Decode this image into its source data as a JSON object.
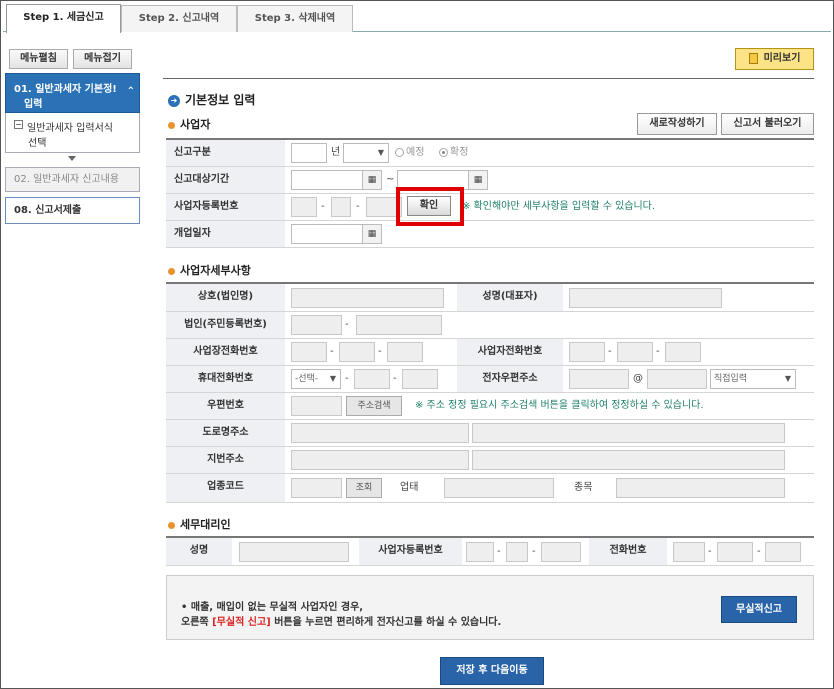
{
  "tabs": [
    "Step 1. 세금신고",
    "Step 2. 신고내역",
    "Step 3. 삭제내역"
  ],
  "sidebar": {
    "expand_label": "메뉴펼침",
    "collapse_label": "메뉴접기",
    "items": [
      {
        "label": "01. 일반과세자 기본정보 입력",
        "label1": "01. 일반과세자 기본정!",
        "label2": "입력"
      },
      {
        "label": "일반과세자 입력서식 선택",
        "label1": "일반과세자 입력서식",
        "label2": "선택"
      },
      {
        "label": "02. 일반과세자 신고내용"
      },
      {
        "label": "08. 신고서제출"
      }
    ]
  },
  "preview_label": "미리보기",
  "page_title": "기본정보 입력",
  "sections": {
    "business": "사업자",
    "details": "사업자세부사항",
    "agent": "세무대리인"
  },
  "buttons": {
    "new": "새로작성하기",
    "load": "신고서 불러오기",
    "confirm": "확인",
    "address_search": "주소검색",
    "lookup": "조회",
    "no_business_report": "무실적신고",
    "save_next": "저장 후 다음이동"
  },
  "labels": {
    "report_type": "신고구분",
    "period": "신고대상기간",
    "biz_reg_no": "사업자등록번호",
    "open_date": "개업일자",
    "company": "상호(법인명)",
    "rep_name": "성명(대표자)",
    "corp_reg_no": "법인(주민등록번호)",
    "office_phone": "사업장전화번호",
    "biz_phone": "사업자전화번호",
    "mobile": "휴대전화번호",
    "email": "전자우편주소",
    "zipcode": "우편번호",
    "road_address": "도로명주소",
    "lot_address": "지번주소",
    "industry_code": "업종코드",
    "business_type": "업태",
    "item": "종목",
    "agent_name": "성명",
    "agent_biz_no": "사업자등록번호",
    "agent_phone": "전화번호"
  },
  "text": {
    "year": "년",
    "tilde": "~",
    "dash": "-",
    "at": "@",
    "radio_planned": "예정",
    "radio_final": "확정",
    "confirm_note": "※ 확인해야만 세부사항을 입력할 수 있습니다.",
    "address_note": "※ 주소 정정 필요시 주소검색 버튼을 클릭하여 정정하실 수 있습니다.",
    "mobile_select": "-선택-",
    "email_select": "직접입력"
  },
  "info": {
    "line1": "• 매출, 매입이 없는 무실적 사업자인 경우,",
    "line2_pre": "오른쪽 ",
    "line2_red": "[무실적 신고]",
    "line2_post": " 버튼을 누르면 편리하게 전자신고를 하실 수 있습니다."
  },
  "icons": {
    "page_title": "arrow-circle-icon",
    "section": "orange-dot-icon",
    "calendar": "calendar-icon",
    "preview": "document-icon"
  }
}
